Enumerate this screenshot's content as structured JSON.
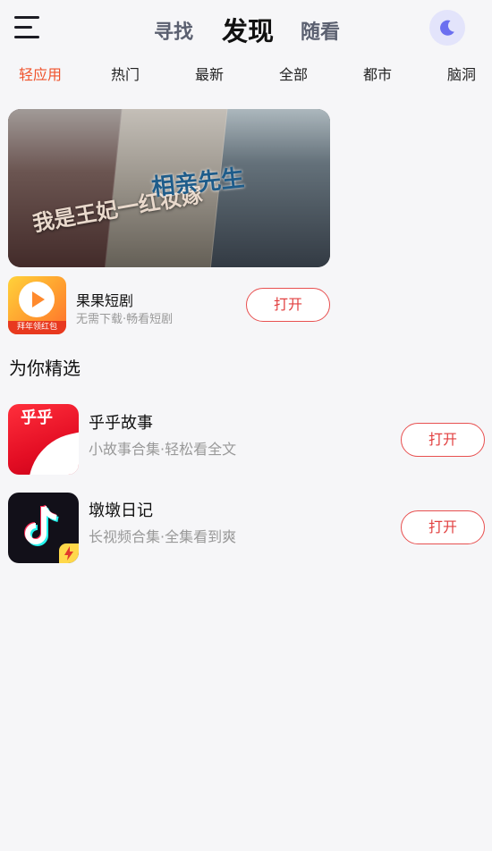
{
  "header": {
    "tabs": [
      "寻找",
      "发现",
      "随看"
    ],
    "active_tab": "发现",
    "menu_icon": "hamburger-menu-icon",
    "night_icon": "moon-icon",
    "night_accent": "#6b6ff0"
  },
  "categories": {
    "items": [
      "轻应用",
      "热门",
      "最新",
      "全部",
      "都市",
      "脑洞"
    ],
    "active": "轻应用",
    "active_color": "#f0532b"
  },
  "banner": {
    "title_left": "我是王妃一红妆嫁",
    "title_center": "相亲先生"
  },
  "featured_app": {
    "name": "果果短剧",
    "description": "无需下载·畅看短剧",
    "icon_ribbon": "拜年领红包",
    "button": "打开"
  },
  "section": {
    "title": "为你精选"
  },
  "apps": [
    {
      "name": "乎乎故事",
      "description": "小故事合集·轻松看全文",
      "button": "打开",
      "icon_glyph": "乎乎"
    },
    {
      "name": "墩墩日记",
      "description": "长视频合集·全集看到爽",
      "button": "打开"
    }
  ],
  "colors": {
    "accent": "#f0532b",
    "button_border": "#e85050",
    "background": "#f6f6f8"
  }
}
